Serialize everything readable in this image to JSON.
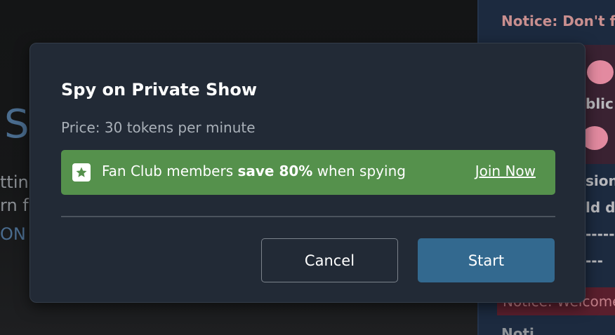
{
  "background": {
    "left_big_text": "S",
    "left_lines": [
      "ttin",
      "rn f",
      "ON"
    ],
    "chat_notice": "Notice: Don't fo",
    "chat_fragments": [
      "blic",
      "sion",
      "ld da",
      "-------",
      "---"
    ],
    "chat_welcome": "Notice: Welcome",
    "chat_bottom": "Noti"
  },
  "modal": {
    "title": "Spy on Private Show",
    "price": "Price: 30 tokens per minute",
    "promo": {
      "icon": "star-icon",
      "text_before": "Fan Club members ",
      "text_bold": "save 80%",
      "text_after": " when spying",
      "link_label": "Join Now"
    },
    "buttons": {
      "cancel_label": "Cancel",
      "start_label": "Start"
    }
  },
  "colors": {
    "modal_bg": "#222a36",
    "promo_bg": "#55914c",
    "start_bg": "#33698f"
  }
}
